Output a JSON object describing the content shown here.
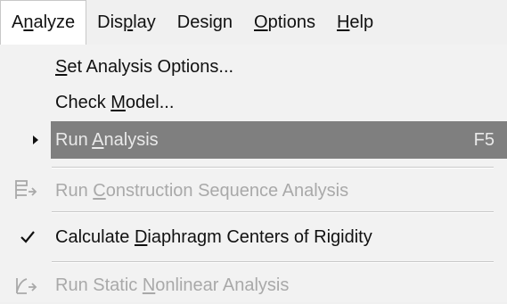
{
  "menubar": {
    "items": [
      {
        "pre": "A",
        "key": "n",
        "post": "alyze"
      },
      {
        "pre": "Dis",
        "key": "p",
        "post": "lay"
      },
      {
        "pre": "Desi",
        "key": "g",
        "post": "n"
      },
      {
        "pre": "",
        "key": "O",
        "post": "ptions"
      },
      {
        "pre": "",
        "key": "H",
        "post": "elp"
      }
    ]
  },
  "menu": {
    "items": [
      {
        "pre": "",
        "key": "S",
        "post": "et Analysis Options..."
      },
      {
        "pre": "Check ",
        "key": "M",
        "post": "odel..."
      },
      {
        "pre": "Run ",
        "key": "A",
        "post": "nalysis",
        "shortcut": "F5"
      },
      {
        "pre": "Run ",
        "key": "C",
        "post": "onstruction Sequence Analysis"
      },
      {
        "pre": "Calculate ",
        "key": "D",
        "post": "iaphragm Centers of Rigidity"
      },
      {
        "pre": "Run Static ",
        "key": "N",
        "post": "onlinear Analysis"
      }
    ]
  },
  "icons": {
    "submenu": "submenu-arrow-icon",
    "construction": "construction-sequence-icon",
    "check": "checkmark-icon",
    "nonlinear": "nonlinear-analysis-icon"
  },
  "colors": {
    "highlight_bg": "#7f7f7f",
    "highlight_text": "#e9e9e9",
    "disabled_text": "#a9a9a9",
    "menu_bg": "#f2f2f2"
  }
}
